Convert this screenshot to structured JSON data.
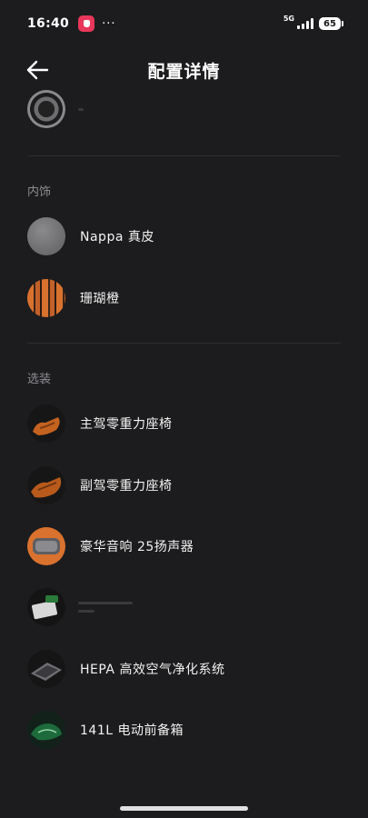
{
  "status_bar": {
    "time": "16:40",
    "dots": "···",
    "network": "5G",
    "battery": "65"
  },
  "header": {
    "title": "配置详情"
  },
  "sections": {
    "interior": {
      "title": "内饰",
      "items": [
        {
          "label": "Nappa 真皮",
          "thumb": "gray-leather-swatch"
        },
        {
          "label": "珊瑚橙",
          "thumb": "coral-orange-swatch"
        }
      ]
    },
    "options": {
      "title": "选装",
      "items": [
        {
          "label": "主驾零重力座椅",
          "thumb": "driver-seat-image"
        },
        {
          "label": "副驾零重力座椅",
          "thumb": "passenger-seat-image"
        },
        {
          "label": "豪华音响 25扬声器",
          "thumb": "speaker-image"
        },
        {
          "label": "HEPA 高效空气净化系统",
          "thumb": "air-filter-image"
        },
        {
          "label": "141L 电动前备箱",
          "thumb": "frunk-image"
        }
      ]
    }
  },
  "colors": {
    "background": "#1c1c1e",
    "accent_orange": "#d9722e",
    "muted_text": "#8d8d92"
  }
}
